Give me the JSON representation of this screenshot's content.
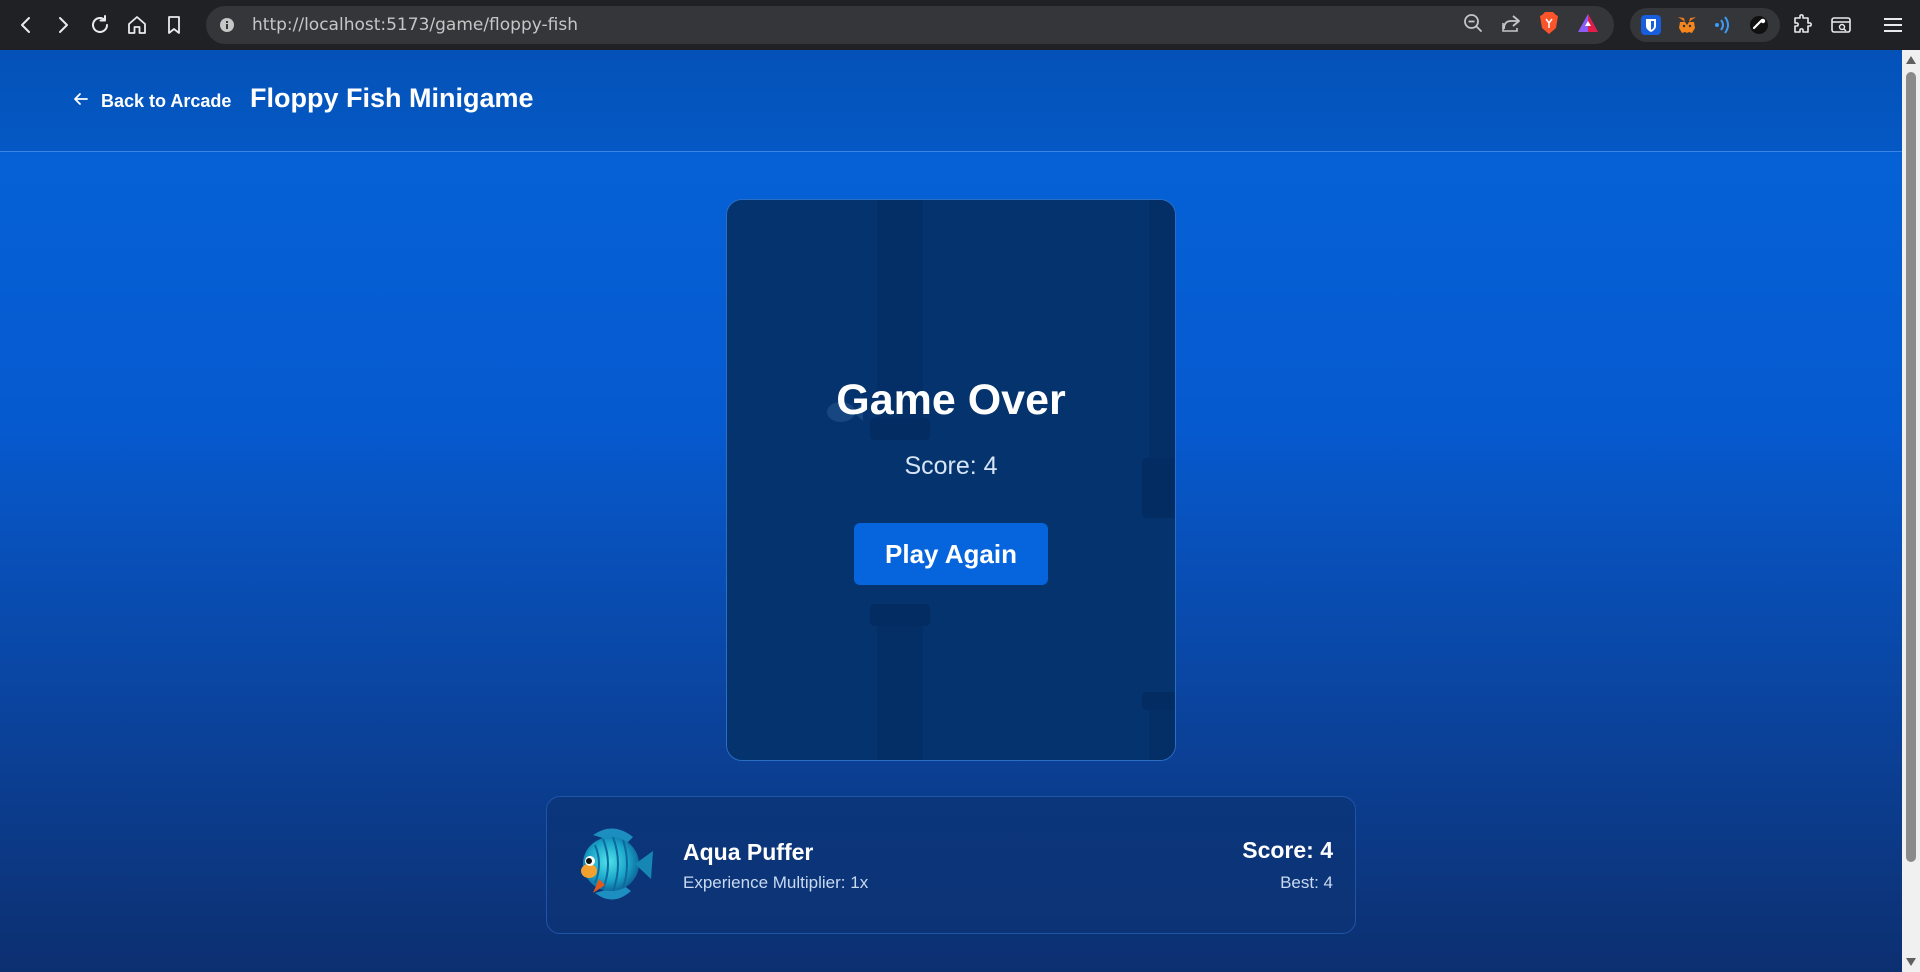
{
  "browser": {
    "url": "http://localhost:5173/game/floppy-fish"
  },
  "header": {
    "back_label": "Back to Arcade",
    "title": "Floppy Fish Minigame"
  },
  "game": {
    "over_title": "Game Over",
    "score_text": "Score: 4",
    "play_again_label": "Play Again"
  },
  "fish_card": {
    "name": "Aqua Puffer",
    "multiplier": "Experience Multiplier: 1x",
    "score": "Score: 4",
    "best": "Best: 4"
  },
  "colors": {
    "accent": "#0664dc",
    "page_top": "#0458c6",
    "page_bottom": "#0c2f70"
  }
}
